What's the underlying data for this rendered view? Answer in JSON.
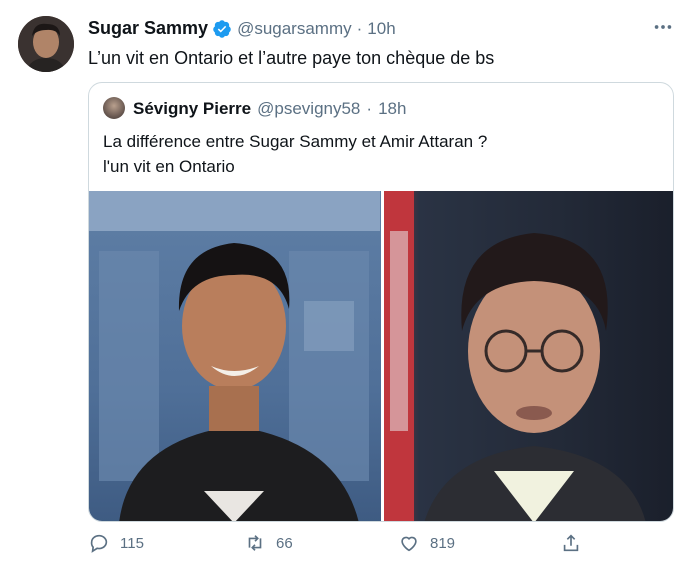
{
  "tweet": {
    "author_name": "Sugar Sammy",
    "handle": "@sugarsammy",
    "separator": "·",
    "time": "10h",
    "text": "L’un vit en Ontario et l’autre paye ton chèque de bs"
  },
  "quote": {
    "author_name": "Sévigny Pierre",
    "handle": "@psevigny58",
    "separator": "·",
    "time": "18h",
    "text_line1": "La différence entre Sugar Sammy et Amir Attaran ?",
    "text_line2": "l'un vit en Ontario"
  },
  "actions": {
    "replies": "115",
    "retweets": "66",
    "likes": "819"
  },
  "colors": {
    "verified": "#1d9bf0",
    "muted": "#5b7083",
    "border": "#cfd9de"
  },
  "icons": [
    "verified-badge-icon",
    "more-icon",
    "reply-icon",
    "retweet-icon",
    "like-icon",
    "share-icon"
  ]
}
